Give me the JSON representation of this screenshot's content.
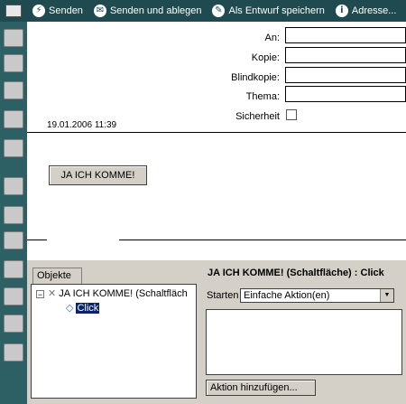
{
  "toolbar": {
    "buttons": [
      {
        "icon": "lightning-icon",
        "glyph": "⚡",
        "label": "Senden"
      },
      {
        "icon": "send-file-icon",
        "glyph": "✉",
        "label": "Senden und ablegen"
      },
      {
        "icon": "draft-icon",
        "glyph": "✎",
        "label": "Als Entwurf speichern"
      },
      {
        "icon": "address-icon",
        "glyph": "i",
        "label": "Adresse..."
      }
    ]
  },
  "header": {
    "date": "19.01.2006 11:39",
    "fields": {
      "an": "An:",
      "kopie": "Kopie:",
      "blindkopie": "Blindkopie:",
      "thema": "Thema:",
      "sicherheit": "Sicherheit"
    }
  },
  "body": {
    "button_label": "JA ICH KOMME!"
  },
  "objects_panel": {
    "tab_label": "Objekte",
    "tree_root": "JA ICH KOMME! (Schaltfläch",
    "tree_child": "Click"
  },
  "action_panel": {
    "title": "JA ICH KOMME! (Schaltfläche) : Click",
    "starten_label": "Starten",
    "select_value": "Einfache Aktion(en)",
    "add_button": "Aktion hinzufügen..."
  }
}
